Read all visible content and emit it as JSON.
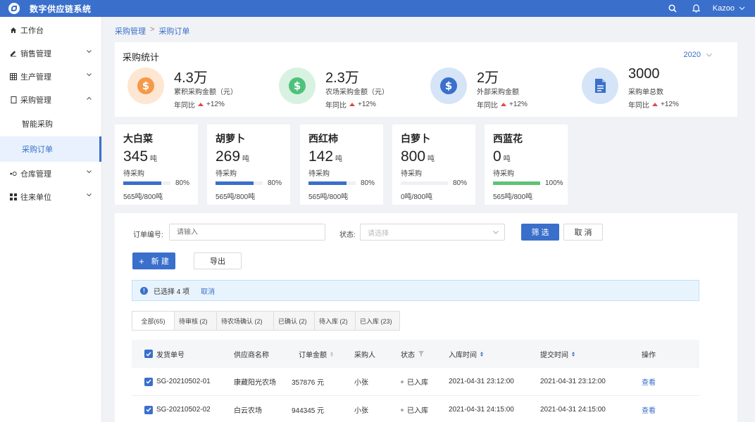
{
  "app": {
    "title": "数字供应链系统",
    "user": "Kazoo"
  },
  "sidebar": {
    "items": [
      {
        "label": "工作台"
      },
      {
        "label": "销售管理"
      },
      {
        "label": "生产管理"
      },
      {
        "label": "采购管理"
      },
      {
        "label": "智能采购"
      },
      {
        "label": "采购订单"
      },
      {
        "label": "仓库管理"
      },
      {
        "label": "往来单位"
      }
    ]
  },
  "breadcrumb": {
    "parent": "采购管理",
    "sep": ">",
    "current": "采购订单"
  },
  "stats": {
    "title": "采购统计",
    "year": "2020",
    "yoy_label": "年同比",
    "items": [
      {
        "value": "4.3万",
        "label": "累积采购金额（元）",
        "yoy": "+12%",
        "color": "#f5994a",
        "bg": "#fde7d3",
        "icon": "dollar-coin-icon"
      },
      {
        "value": "2.3万",
        "label": "农场采购金额（元）",
        "yoy": "+12%",
        "color": "#4fc27a",
        "bg": "#d8f2e1",
        "icon": "dollar-coin-icon"
      },
      {
        "value": "2万",
        "label": "外部采购金额",
        "yoy": "+12%",
        "color": "#3a6fcb",
        "bg": "#d6e4f8",
        "icon": "dollar-coin-icon"
      },
      {
        "value": "3000",
        "label": "采购单总数",
        "yoy": "+12%",
        "color": "#3a6fcb",
        "bg": "#d6e4f8",
        "icon": "document-icon"
      }
    ]
  },
  "veg": [
    {
      "name": "大白菜",
      "num": "345",
      "unit": "吨",
      "status": "待采购",
      "pct": "80%",
      "fill": 0.8,
      "qty": "565吨/800吨"
    },
    {
      "name": "胡萝卜",
      "num": "269",
      "unit": "吨",
      "status": "待采购",
      "pct": "80%",
      "fill": 0.8,
      "qty": "565吨/800吨"
    },
    {
      "name": "西红柿",
      "num": "142",
      "unit": "吨",
      "status": "待采购",
      "pct": "80%",
      "fill": 0.8,
      "qty": "565吨/800吨"
    },
    {
      "name": "白萝卜",
      "num": "800",
      "unit": "吨",
      "status": "待采购",
      "pct": "80%",
      "fill": 0,
      "qty": "0吨/800吨"
    },
    {
      "name": "西蓝花",
      "num": "0",
      "unit": "吨",
      "status": "待采购",
      "pct": "100%",
      "fill": 1.0,
      "qty": "565吨/800吨"
    }
  ],
  "filter": {
    "order_no_label": "订单编号:",
    "order_no_placeholder": "请输入",
    "status_label": "状态:",
    "status_placeholder": "请选择",
    "filter_btn": "筛 选",
    "cancel_btn": "取 消",
    "new_btn": "新 建",
    "export_btn": "导出"
  },
  "alert": {
    "text": "已选择 4 项",
    "cancel": "取消"
  },
  "tabs": [
    {
      "label": "全部(65)"
    },
    {
      "label": "待审核 (2)"
    },
    {
      "label": "待农场确认 (2)"
    },
    {
      "label": "已确认 (2)"
    },
    {
      "label": "待入库 (2)"
    },
    {
      "label": "已入库 (23)"
    }
  ],
  "table": {
    "headers": {
      "order_no": "发货单号",
      "supplier": "供应商名称",
      "amount": "订单金额",
      "buyer": "采购人",
      "status": "状态",
      "stock_in_time": "入库时间",
      "submit_time": "提交时间",
      "action": "操作"
    },
    "rows": [
      {
        "order_no": "SG-20210502-01",
        "supplier": "康藏阳光农场",
        "amount": "357876 元",
        "buyer": "小张",
        "status": "已入库",
        "stock_in_time": "2021-04-31  23:12:00",
        "submit_time": "2021-04-31  23:12:00",
        "action": "查看"
      },
      {
        "order_no": "SG-20210502-02",
        "supplier": "白云农场",
        "amount": "944345 元",
        "buyer": "小张",
        "status": "已入库",
        "stock_in_time": "2021-04-31  24:15:00",
        "submit_time": "2021-04-31  24:15:00",
        "action": "查看"
      }
    ]
  }
}
